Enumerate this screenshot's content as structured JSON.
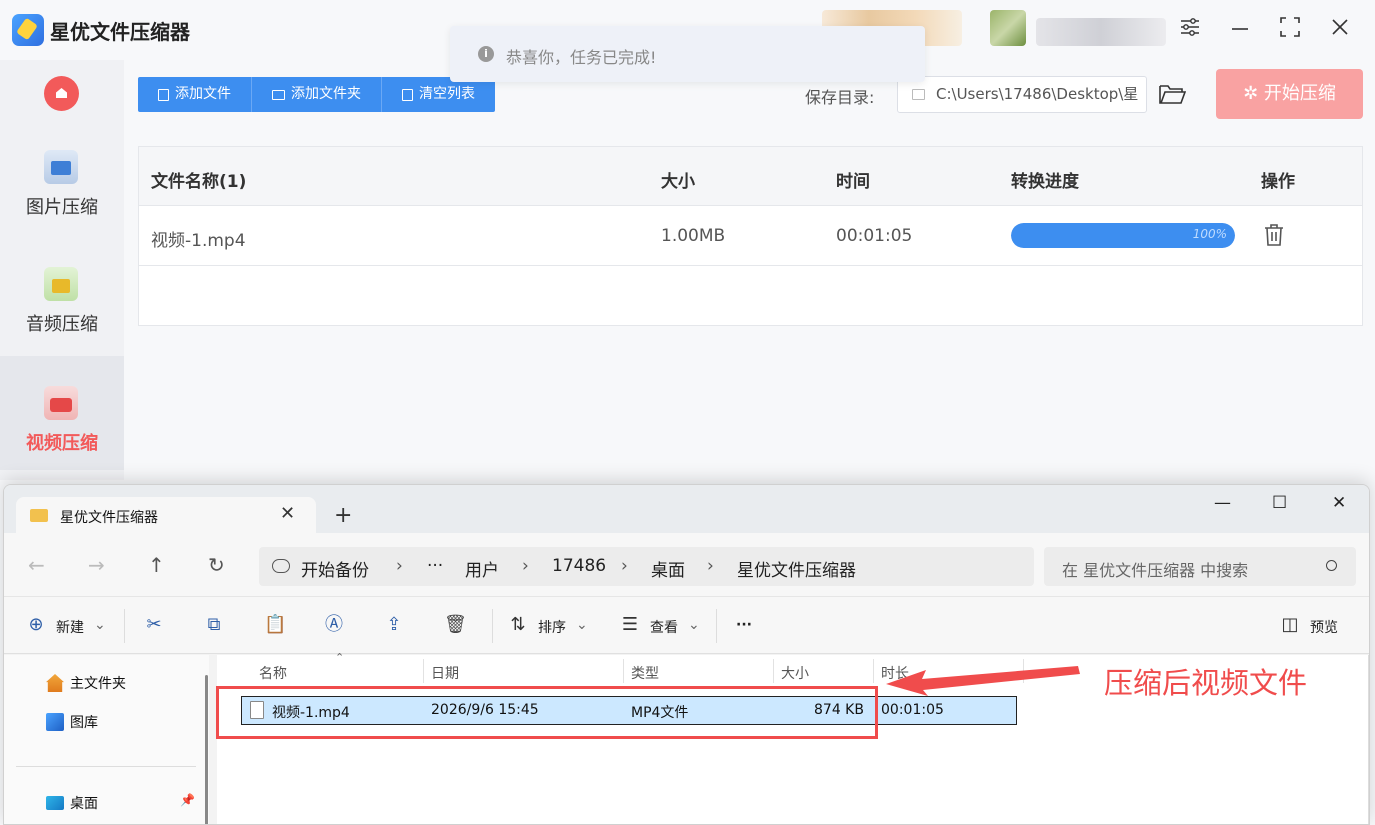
{
  "app": {
    "title": "星优文件压缩器",
    "toast": "恭喜你，任务已完成!",
    "sidebar": [
      {
        "label": "图片压缩",
        "icon": "image-icon",
        "active": false
      },
      {
        "label": "音频压缩",
        "icon": "music-icon",
        "active": false
      },
      {
        "label": "视频压缩",
        "icon": "video-icon",
        "active": true
      }
    ],
    "toolbar": {
      "add_file": "添加文件",
      "add_folder": "添加文件夹",
      "clear_list": "清空列表",
      "save_label": "保存目录:",
      "save_path": "C:\\Users\\17486\\Desktop\\星",
      "start": "✲ 开始压缩"
    },
    "table": {
      "headers": {
        "name": "文件名称(1)",
        "size": "大小",
        "time": "时间",
        "progress": "转换进度",
        "action": "操作"
      },
      "rows": [
        {
          "name": "视频-1.mp4",
          "size": "1.00MB",
          "time": "00:01:05",
          "progress_text": "100%",
          "progress": 1.0
        }
      ]
    },
    "colors": {
      "accent": "#3d8ef0",
      "danger": "#f25a5a",
      "start_btn": "#f9a2a2"
    }
  },
  "explorer": {
    "tab_title": "星优文件压缩器",
    "address": {
      "root": "开始备份",
      "ellipsis": "···",
      "parts": [
        "用户",
        "17486",
        "桌面",
        "星优文件压缩器"
      ]
    },
    "search_placeholder": "在 星优文件压缩器 中搜索",
    "commands": {
      "new": "新建",
      "sort": "排序",
      "view": "查看",
      "more": "···",
      "preview": "预览"
    },
    "nav": {
      "home": "主文件夹",
      "gallery": "图库",
      "desktop": "桌面"
    },
    "columns": {
      "name": "名称",
      "date": "日期",
      "type": "类型",
      "size": "大小",
      "duration": "时长"
    },
    "files": [
      {
        "name": "视频-1.mp4",
        "date": "2026/9/6 15:45",
        "type": "MP4文件",
        "size": "874 KB",
        "duration": "00:01:05"
      }
    ]
  },
  "annotation": {
    "text": "压缩后视频文件",
    "color": "#f04c4c"
  }
}
